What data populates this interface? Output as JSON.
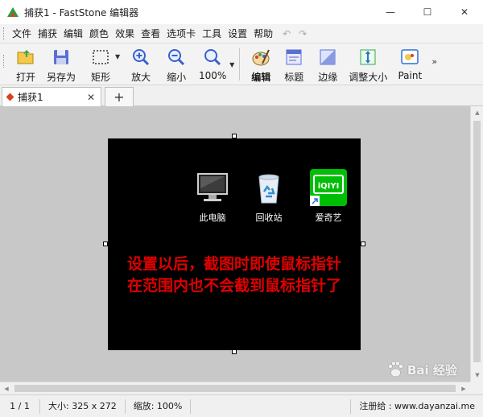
{
  "window": {
    "title": "捕获1 - FastStone 编辑器",
    "minimize_glyph": "—",
    "maximize_glyph": "☐",
    "close_glyph": "✕"
  },
  "menu": {
    "items": [
      "文件",
      "捕获",
      "编辑",
      "颜色",
      "效果",
      "查看",
      "选项卡",
      "工具",
      "设置",
      "帮助"
    ],
    "undo_glyph": "↶",
    "redo_glyph": "↷"
  },
  "toolbar": {
    "open": "打开",
    "save_as": "另存为",
    "rectangle": "矩形",
    "zoom_in": "放大",
    "zoom_out": "缩小",
    "zoom_level": "100%",
    "edit": "编辑",
    "caption": "标题",
    "edge": "边缘",
    "resize": "调整大小",
    "paint": "Paint",
    "overflow_glyph": "»"
  },
  "tabs": {
    "items": [
      {
        "label": "捕获1",
        "close_glyph": "✕"
      }
    ],
    "add_glyph": "+"
  },
  "capture": {
    "desktop_icons": [
      {
        "label": "此电脑",
        "icon": "computer-icon"
      },
      {
        "label": "回收站",
        "icon": "recycle-bin-icon"
      },
      {
        "label": "爱奇艺",
        "icon": "iqiyi-icon",
        "badge_text": "iQIYI"
      }
    ],
    "overlay_lines": [
      "设置以后，截图时即使鼠标指针",
      "在范围内也不会截到鼠标指针了"
    ],
    "overlay_color": "#e00000"
  },
  "statusbar": {
    "page": "1 / 1",
    "size": "大小: 325 x 272",
    "zoom": "缩放: 100%",
    "registration": "注册给 : www.dayanzai.me"
  },
  "watermark": {
    "text": "Bai 经验"
  },
  "colors": {
    "canvas_bg": "#c8c8c8",
    "capture_bg": "#000000",
    "iqiyi_green": "#00be06"
  }
}
